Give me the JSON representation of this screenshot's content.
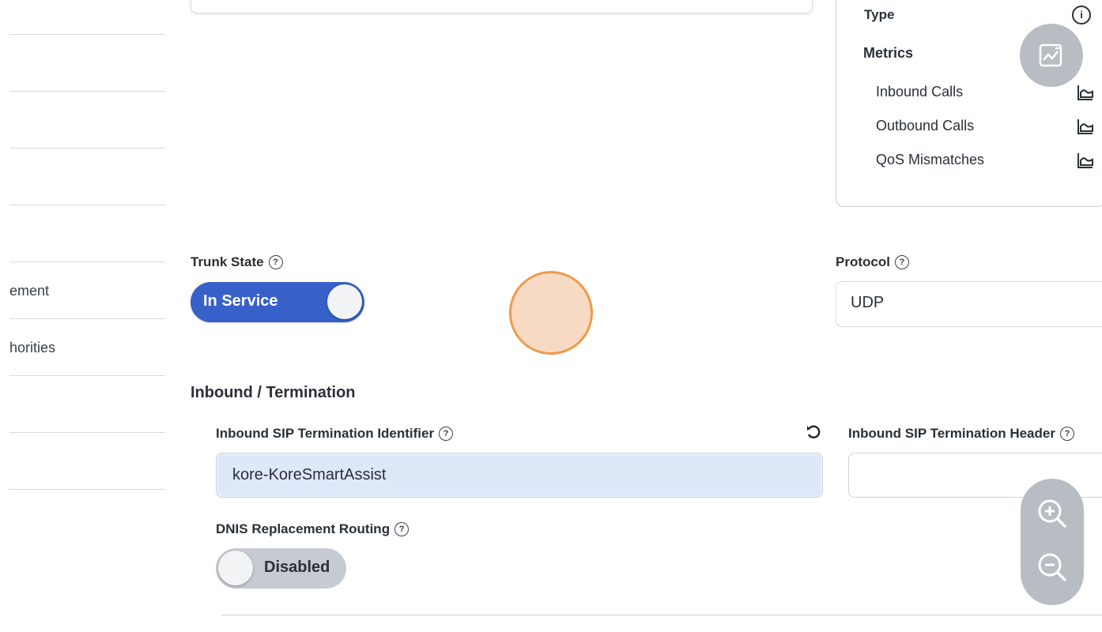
{
  "leftnav": {
    "items": [
      {
        "label": ""
      },
      {
        "label": ""
      },
      {
        "label": ""
      },
      {
        "label": ""
      },
      {
        "label": "ement"
      },
      {
        "label": "horities"
      },
      {
        "label": ""
      },
      {
        "label": ""
      }
    ]
  },
  "info_card": {
    "type_label": "Type",
    "type_help_glyph": "i",
    "metrics_label": "Metrics",
    "metrics": [
      {
        "label": "Inbound Calls",
        "icon": "area-chart-icon"
      },
      {
        "label": "Outbound Calls",
        "icon": "area-chart-icon"
      },
      {
        "label": "QoS Mismatches",
        "icon": "area-chart-icon"
      }
    ]
  },
  "trunk_state": {
    "label": "Trunk State",
    "toggle_label": "In Service",
    "enabled": true
  },
  "protocol": {
    "label": "Protocol",
    "value": "UDP"
  },
  "inbound": {
    "section_title": "Inbound / Termination",
    "sip_identifier_label": "Inbound SIP Termination Identifier",
    "sip_identifier_value": "kore-KoreSmartAssist",
    "sip_header_label": "Inbound SIP Termination Header",
    "sip_header_value": "",
    "dnis_label": "DNIS Replacement Routing",
    "dnis_toggle_label": "Disabled",
    "dnis_enabled": false
  },
  "help_glyph": "?",
  "colors": {
    "primary": "#3760c9",
    "toggle_off": "#c6cad1",
    "input_focus_bg": "#dde8f9",
    "fab_bg": "#b8bcc3",
    "touch_fill": "#f6d4b9",
    "touch_border": "#ef9a4b"
  }
}
